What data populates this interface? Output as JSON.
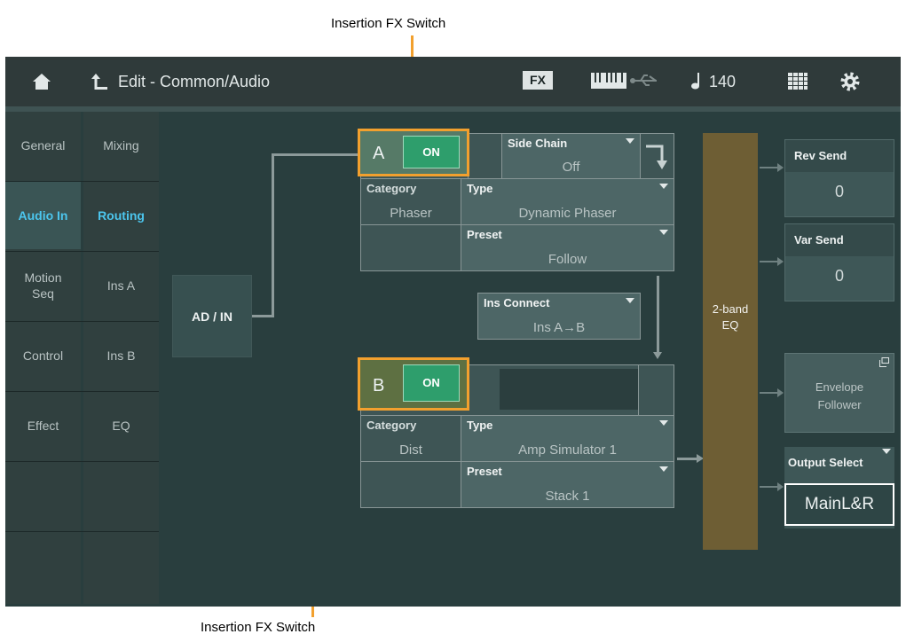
{
  "callouts": {
    "top": "Insertion FX Switch",
    "bottom": "Insertion FX Switch"
  },
  "header": {
    "title": "Edit - Common/Audio",
    "fx_badge": "FX",
    "tempo": "140"
  },
  "tabs_left": [
    {
      "label": "General"
    },
    {
      "label": "Audio In"
    },
    {
      "label": "Motion\nSeq"
    },
    {
      "label": "Control"
    },
    {
      "label": "Effect"
    }
  ],
  "tabs_right": [
    {
      "label": "Mixing"
    },
    {
      "label": "Routing"
    },
    {
      "label": "Ins A"
    },
    {
      "label": "Ins B"
    },
    {
      "label": "EQ"
    }
  ],
  "routing": {
    "input": "AD / IN",
    "ins_a": {
      "letter": "A",
      "switch": "ON",
      "side_chain_label": "Side Chain",
      "side_chain_value": "Off",
      "category_label": "Category",
      "category_value": "Phaser",
      "type_label": "Type",
      "type_value": "Dynamic Phaser",
      "preset_label": "Preset",
      "preset_value": "Follow"
    },
    "ins_connect_label": "Ins Connect",
    "ins_connect_value": "Ins A→B",
    "ins_b": {
      "letter": "B",
      "switch": "ON",
      "category_label": "Category",
      "category_value": "Dist",
      "type_label": "Type",
      "type_value": "Amp Simulator 1",
      "preset_label": "Preset",
      "preset_value": "Stack 1"
    },
    "eq": "2-band\nEQ",
    "rev_send": {
      "label": "Rev Send",
      "value": "0"
    },
    "var_send": {
      "label": "Var Send",
      "value": "0"
    },
    "envelope": "Envelope\nFollower",
    "output_select": {
      "label": "Output Select",
      "value": "MainL&R"
    }
  },
  "colors": {
    "accent_blue": "#4cc6ee",
    "switch_green": "#2e9e6c",
    "callout_orange": "#f2a02e",
    "eq_bar": "#6e5e34"
  }
}
